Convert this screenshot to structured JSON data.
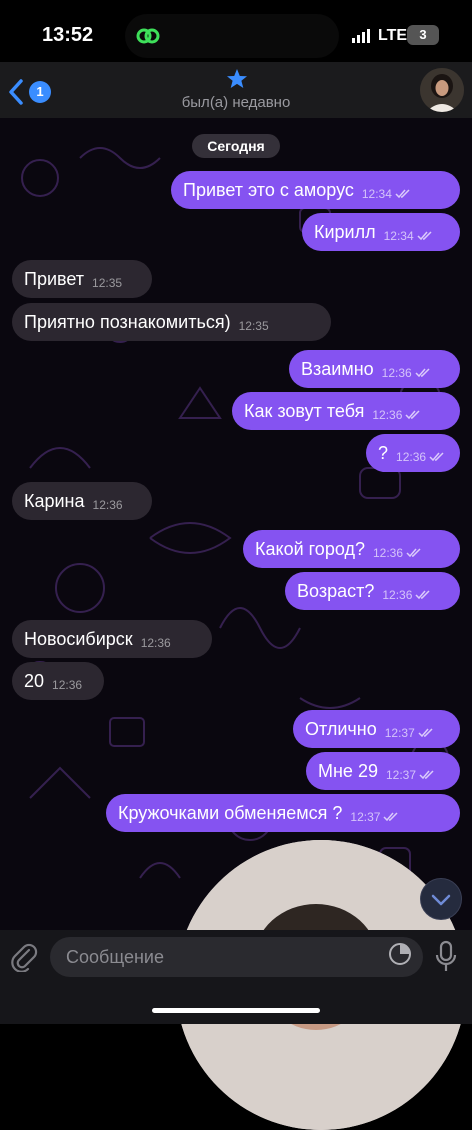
{
  "status_bar": {
    "time": "13:52",
    "network": "LTE",
    "battery": "3"
  },
  "header": {
    "back_count": "1",
    "last_seen": "был(а) недавно"
  },
  "chat": {
    "date": "Сегодня",
    "messages": [
      {
        "text": "Привет это с аморус",
        "time": "12:34",
        "dir": "out"
      },
      {
        "text": "Кирилл",
        "time": "12:34",
        "dir": "out"
      },
      {
        "text": "Привет",
        "time": "12:35",
        "dir": "in"
      },
      {
        "text": "Приятно познакомиться)",
        "time": "12:35",
        "dir": "in"
      },
      {
        "text": "Взаимно",
        "time": "12:36",
        "dir": "out"
      },
      {
        "text": "Как зовут тебя",
        "time": "12:36",
        "dir": "out"
      },
      {
        "text": "?",
        "time": "12:36",
        "dir": "out"
      },
      {
        "text": "Карина",
        "time": "12:36",
        "dir": "in"
      },
      {
        "text": "Какой город?",
        "time": "12:36",
        "dir": "out"
      },
      {
        "text": "Возраст?",
        "time": "12:36",
        "dir": "out"
      },
      {
        "text": "Новосибирск",
        "time": "12:36",
        "dir": "in"
      },
      {
        "text": "20",
        "time": "12:36",
        "dir": "in"
      },
      {
        "text": "Отлично",
        "time": "12:37",
        "dir": "out"
      },
      {
        "text": "Мне 29",
        "time": "12:37",
        "dir": "out"
      },
      {
        "text": "Кружочками обменяемся ?",
        "time": "12:37",
        "dir": "out"
      }
    ]
  },
  "composer": {
    "placeholder": "Сообщение"
  },
  "colors": {
    "outgoing": "#8553f1",
    "incoming": "#2c2730",
    "accent": "#3a8dff"
  },
  "icons": [
    "back-chevron-icon",
    "star-icon",
    "attach-icon",
    "sticker-icon",
    "mic-icon",
    "scroll-down-icon",
    "read-checks-icon"
  ]
}
